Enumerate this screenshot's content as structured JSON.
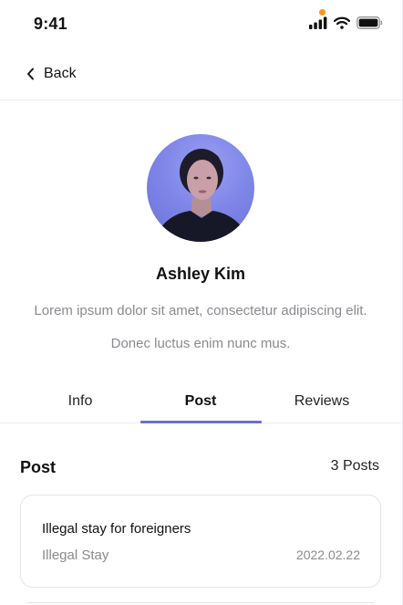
{
  "status_bar": {
    "time": "9:41"
  },
  "nav": {
    "back_label": "Back"
  },
  "profile": {
    "name": "Ashley Kim",
    "bio": "Lorem ipsum dolor sit amet, consectetur adipiscing elit. Donec luctus enim nunc mus."
  },
  "tabs": [
    {
      "label": "Info",
      "active": false
    },
    {
      "label": "Post",
      "active": true
    },
    {
      "label": "Reviews",
      "active": false
    }
  ],
  "post_section": {
    "title": "Post",
    "count": "3 Posts",
    "posts": [
      {
        "title": "Illegal stay for foreigners",
        "category": "Illegal Stay",
        "date": "2022.02.22"
      }
    ]
  },
  "colors": {
    "accent": "#6b6fd4",
    "privacy_dot": "#f39a1c",
    "muted_text": "#8a8a8f"
  }
}
